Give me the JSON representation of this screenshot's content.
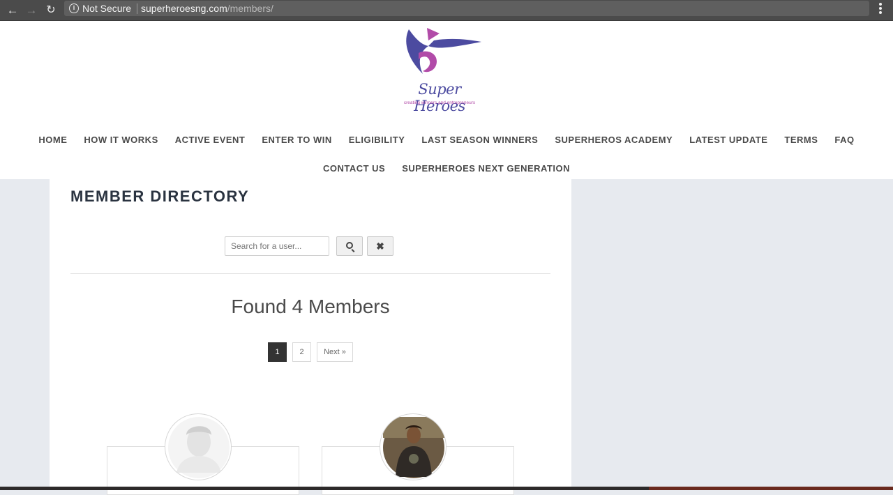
{
  "browser": {
    "security_label": "Not Secure",
    "url_host": "superheroesng.com",
    "url_path": "/members/"
  },
  "logo": {
    "title": "Super Heroes",
    "tagline": "creating winners and entrepreneurs",
    "colors": {
      "blue": "#4c4ba0",
      "purple": "#b14ba8"
    }
  },
  "nav": {
    "row1": [
      "HOME",
      "HOW IT WORKS",
      "ACTIVE EVENT",
      "ENTER TO WIN",
      "ELIGIBILITY",
      "LAST SEASON WINNERS",
      "SUPERHEROS ACADEMY",
      "LATEST UPDATE",
      "TERMS",
      "FAQ"
    ],
    "row2": [
      "CONTACT US",
      "SUPERHEROES NEXT GENERATION"
    ]
  },
  "directory": {
    "title": "MEMBER DIRECTORY",
    "search_placeholder": "Search for a user...",
    "search_value": "",
    "found_text": "Found 4 Members",
    "pagination": {
      "current": "1",
      "page2": "2",
      "next": "Next »"
    }
  },
  "members": [
    {
      "avatar": "default-silhouette"
    },
    {
      "avatar": "photo"
    }
  ]
}
